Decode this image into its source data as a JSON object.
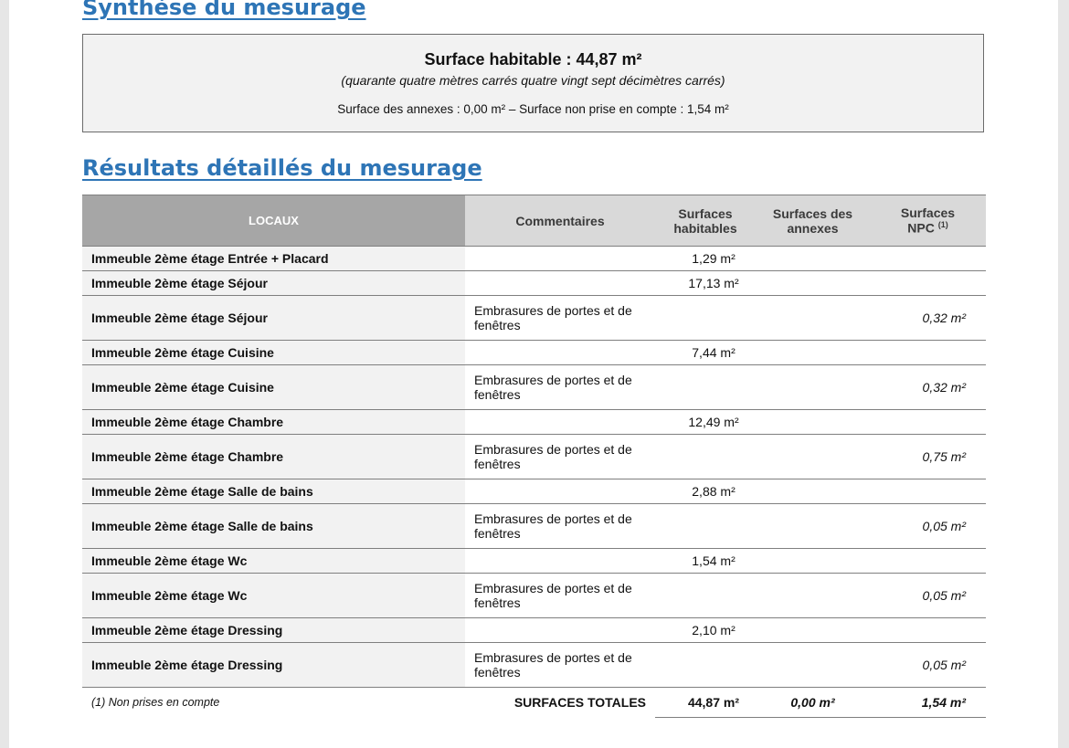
{
  "synthese": {
    "title": "Synthèse du mesurage",
    "surface_habitable": "Surface habitable : 44,87 m²",
    "surface_words": "(quarante quatre  mètres carrés quatre vingt  sept  décimètres carrés)",
    "annexes_line": "Surface des annexes : 0,00 m² – Surface non prise en compte : 1,54 m²"
  },
  "resultats": {
    "title": "Résultats détaillés du mesurage",
    "headers": {
      "locaux": "LOCAUX",
      "commentaires": "Commentaires",
      "hab_line1": "Surfaces",
      "hab_line2": "habitables",
      "annex_line1": "Surfaces des",
      "annex_line2": "annexes",
      "npc_line1": "Surfaces",
      "npc_line2": "NPC",
      "npc_sup": "(1)"
    },
    "rows": [
      {
        "local": "Immeuble 2ème étage Entrée + Placard",
        "comment": "",
        "hab": "1,29 m²",
        "annex": "",
        "npc": ""
      },
      {
        "local": "Immeuble 2ème étage Séjour",
        "comment": "",
        "hab": "17,13 m²",
        "annex": "",
        "npc": ""
      },
      {
        "local": "Immeuble 2ème étage Séjour",
        "comment": "Embrasures de portes et de fenêtres",
        "hab": "",
        "annex": "",
        "npc": "0,32 m²"
      },
      {
        "local": "Immeuble 2ème étage Cuisine",
        "comment": "",
        "hab": "7,44 m²",
        "annex": "",
        "npc": ""
      },
      {
        "local": "Immeuble 2ème étage Cuisine",
        "comment": "Embrasures de portes et de fenêtres",
        "hab": "",
        "annex": "",
        "npc": "0,32 m²"
      },
      {
        "local": "Immeuble 2ème étage Chambre",
        "comment": "",
        "hab": "12,49 m²",
        "annex": "",
        "npc": ""
      },
      {
        "local": "Immeuble 2ème étage Chambre",
        "comment": "Embrasures de portes et de fenêtres",
        "hab": "",
        "annex": "",
        "npc": "0,75 m²"
      },
      {
        "local": "Immeuble 2ème étage Salle de bains",
        "comment": "",
        "hab": "2,88 m²",
        "annex": "",
        "npc": ""
      },
      {
        "local": "Immeuble 2ème étage Salle de bains",
        "comment": "Embrasures de portes et de fenêtres",
        "hab": "",
        "annex": "",
        "npc": "0,05 m²"
      },
      {
        "local": "Immeuble 2ème étage Wc",
        "comment": "",
        "hab": "1,54 m²",
        "annex": "",
        "npc": ""
      },
      {
        "local": "Immeuble 2ème étage Wc",
        "comment": "Embrasures de portes et de fenêtres",
        "hab": "",
        "annex": "",
        "npc": "0,05 m²"
      },
      {
        "local": "Immeuble 2ème étage Dressing",
        "comment": "",
        "hab": "2,10 m²",
        "annex": "",
        "npc": ""
      },
      {
        "local": "Immeuble 2ème étage Dressing",
        "comment": "Embrasures de portes et de fenêtres",
        "hab": "",
        "annex": "",
        "npc": "0,05 m²"
      }
    ],
    "footer": {
      "note": "(1)  Non prises en compte",
      "label": "SURFACES TOTALES",
      "hab": "44,87 m²",
      "annex": "0,00 m²",
      "npc": "1,54 m²"
    }
  }
}
